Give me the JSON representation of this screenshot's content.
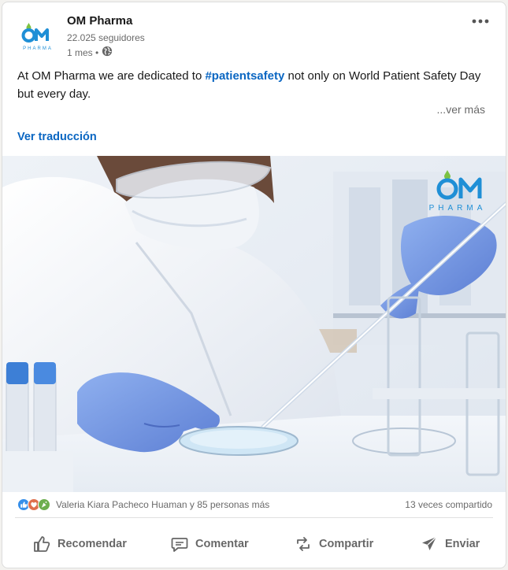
{
  "post": {
    "company_name": "OM Pharma",
    "followers": "22.025 seguidores",
    "time": "1 mes •",
    "text_before": "At OM Pharma we are dedicated to ",
    "hashtag": "#patientsafety",
    "text_after": " not only on World Patient Safety Day but every day.",
    "see_more": "...ver más",
    "translate": "Ver traducción"
  },
  "brand": {
    "logo_text": "OM",
    "logo_sub": "PHARMA",
    "blue": "#1f8fd6",
    "green": "#7cc242"
  },
  "social": {
    "reactions_text": "Valeria Kiara Pacheco Huaman y 85 personas más",
    "shares_text": "13 veces compartido",
    "reaction_icons": [
      "like-icon",
      "love-icon",
      "celebrate-icon",
      "insightful-icon"
    ]
  },
  "actions": {
    "like": "Recomendar",
    "comment": "Comentar",
    "share": "Compartir",
    "send": "Enviar"
  },
  "colors": {
    "link": "#0a66c2"
  }
}
